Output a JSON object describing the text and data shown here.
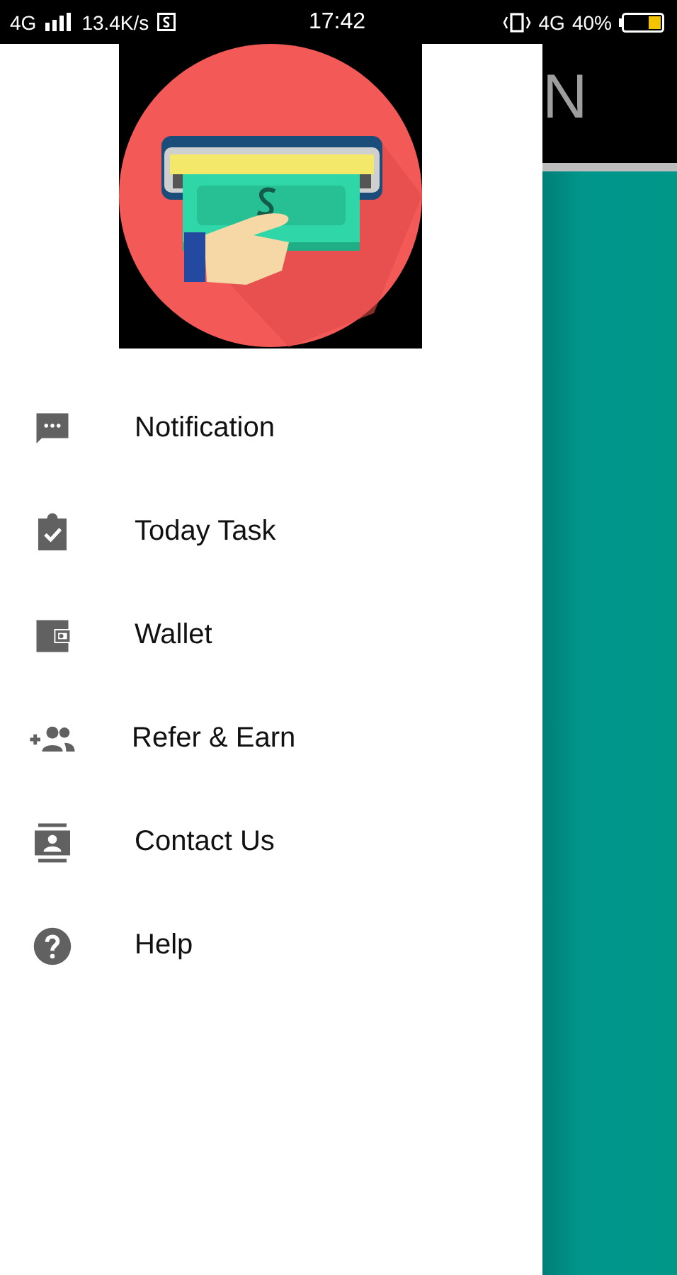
{
  "status_bar": {
    "network": "4G",
    "speed": "13.4K/s",
    "time": "17:42",
    "network_right": "4G",
    "battery": "40%"
  },
  "app_bar": {
    "title": "N"
  },
  "drawer": {
    "items": [
      {
        "label": "Notification",
        "kind": "notification"
      },
      {
        "label": "Today Task",
        "kind": "task"
      },
      {
        "label": "Wallet",
        "kind": "wallet"
      },
      {
        "label": "Refer & Earn",
        "kind": "refer"
      },
      {
        "label": "Contact Us",
        "kind": "contact"
      },
      {
        "label": "Help",
        "kind": "help"
      }
    ]
  }
}
